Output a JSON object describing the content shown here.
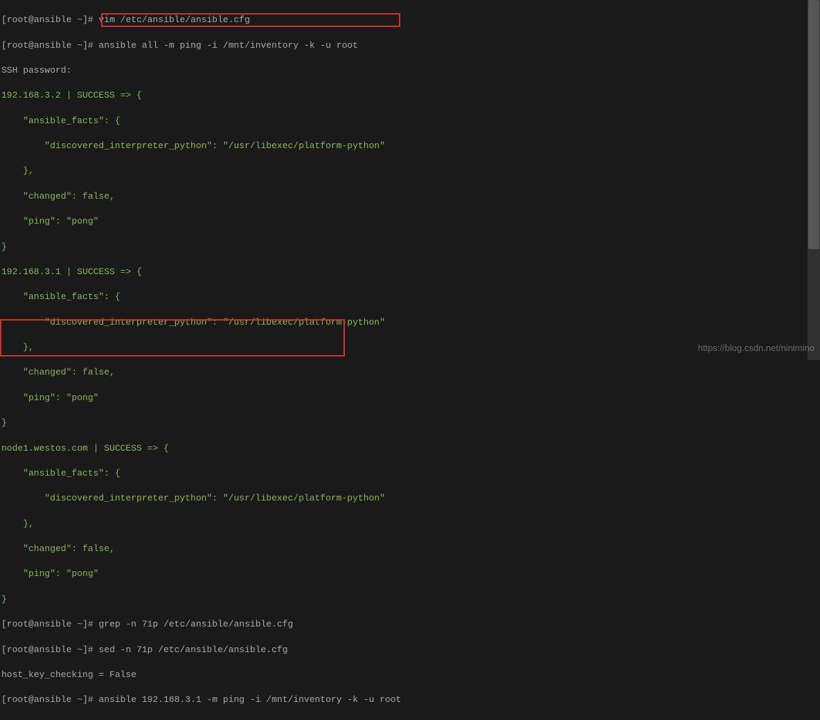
{
  "prompt1": {
    "open": "[",
    "user": "root",
    "at": "@",
    "host": "ansible",
    "path": " ~",
    "close": "]# ",
    "cmd": "vim /etc/ansible/ansible.cfg"
  },
  "prompt2": {
    "open": "[",
    "user": "root",
    "at": "@",
    "host": "ansible",
    "path": " ~",
    "close": "]# ",
    "cmd": "ansible all -m ping -i /mnt/inventory -k -u root"
  },
  "ssh_pw_label": "SSH password:",
  "host_a": {
    "header": "192.168.3.2 | SUCCESS => {",
    "facts_open": "    \"ansible_facts\": {",
    "interp": "        \"discovered_interpreter_python\": \"/usr/libexec/platform-python\"",
    "facts_close": "    },",
    "changed": "    \"changed\": false,",
    "ping": "    \"ping\": \"pong\"",
    "close": "}"
  },
  "host_b": {
    "header": "192.168.3.1 | SUCCESS => {",
    "facts_open": "    \"ansible_facts\": {",
    "interp": "        \"discovered_interpreter_python\": \"/usr/libexec/platform-python\"",
    "facts_close": "    },",
    "changed": "    \"changed\": false,",
    "ping": "    \"ping\": \"pong\"",
    "close": "}"
  },
  "host_c": {
    "header": "node1.westos.com | SUCCESS => {",
    "facts_open": "    \"ansible_facts\": {",
    "interp": "        \"discovered_interpreter_python\": \"/usr/libexec/platform-python\"",
    "facts_close": "    },",
    "changed": "    \"changed\": false,",
    "ping": "    \"ping\": \"pong\"",
    "close": "}"
  },
  "prompt3": {
    "open": "[",
    "user": "root",
    "at": "@",
    "host": "ansible",
    "path": " ~",
    "close": "]# ",
    "cmd": "grep -n 71p /etc/ansible/ansible.cfg"
  },
  "prompt4": {
    "open": "[",
    "user": "root",
    "at": "@",
    "host": "ansible",
    "path": " ~",
    "close": "]# ",
    "cmd": "sed -n 71p /etc/ansible/ansible.cfg"
  },
  "sed_output": "host_key_checking = False",
  "prompt5": {
    "open": "[",
    "user": "root",
    "at": "@",
    "host": "ansible",
    "path": " ~",
    "close": "]# ",
    "cmd": "ansible 192.168.3.1 -m ping -i /mnt/inventory -k -u root"
  },
  "watermark": "https://blog.csdn.net/ninimino"
}
